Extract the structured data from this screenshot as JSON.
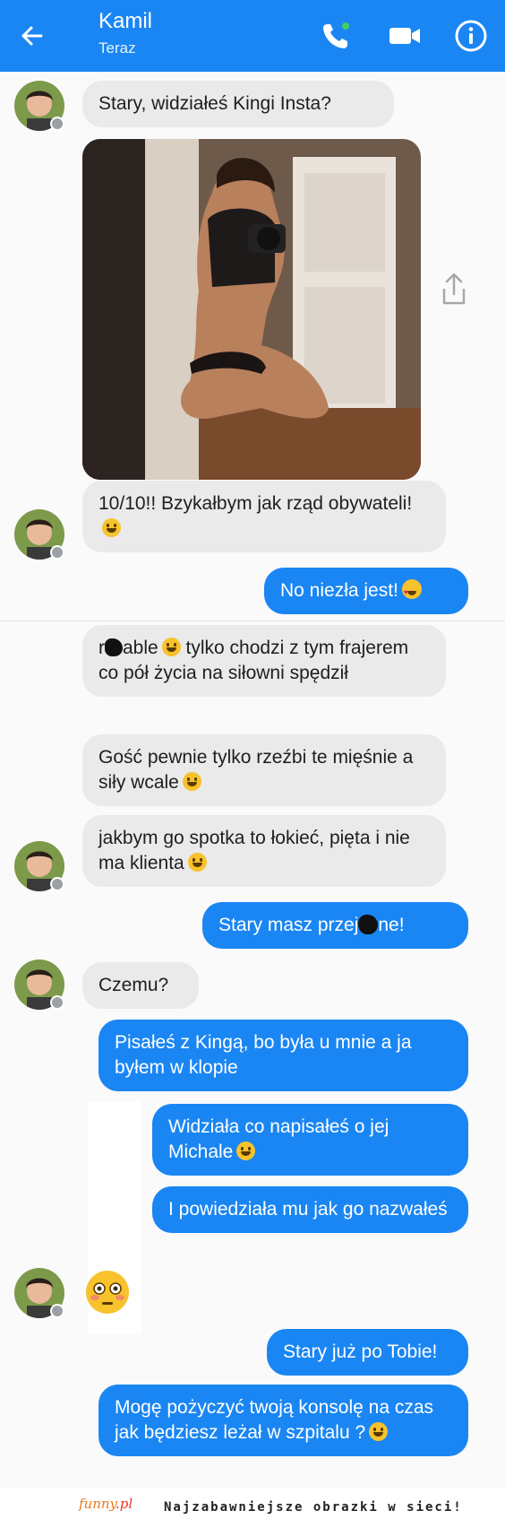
{
  "header": {
    "contact_name": "Kamil",
    "status": "Teraz",
    "back_icon": "back-arrow-icon",
    "call_icon": "phone-icon",
    "video_icon": "video-camera-icon",
    "info_icon": "info-icon",
    "color": "#1a86f3"
  },
  "messages": [
    {
      "from": "Kamil",
      "text": "Stary, widziałeś Kingi Insta?"
    },
    {
      "from": "Kamil",
      "type": "photo"
    },
    {
      "from": "Kamil",
      "text": "10/10!! Bzykałbym jak rząd obywateli!",
      "emoji": "grinning"
    },
    {
      "from": "me",
      "text": "No niezła jest!",
      "emoji": "heart-eyes"
    },
    {
      "from": "Kamil",
      "text_start": "r",
      "text_end": "able",
      "text_rest": "tylko chodzi z tym frajerem co pół życia na siłowni spędził",
      "emoji": "grinning"
    },
    {
      "from": "Kamil",
      "text": "Gość pewnie tylko rzeźbi te mięśnie a siły wcale",
      "emoji": "grinning"
    },
    {
      "from": "Kamil",
      "text": "jakbym go spotka to łokieć, pięta i nie ma klienta",
      "emoji": "grinning"
    },
    {
      "from": "me",
      "text_start": "Stary masz przej",
      "text_end": "ne!"
    },
    {
      "from": "Kamil",
      "text": "Czemu?"
    },
    {
      "from": "me",
      "text": "Pisałeś z Kingą, bo była u mnie a ja byłem w klopie"
    },
    {
      "from": "me",
      "text": "Widziała co napisałeś o jej Michale",
      "emoji": "grinning"
    },
    {
      "from": "me",
      "text": "I powiedziała mu jak go nazwałeś"
    },
    {
      "from": "Kamil",
      "type": "emoji",
      "emoji": "flushed"
    },
    {
      "from": "me",
      "text": "Stary już po Tobie!"
    },
    {
      "from": "me",
      "text": "Mogę pożyczyć twoją konsolę na czas jak będziesz leżał w szpitalu ?",
      "emoji": "grinning"
    }
  ],
  "footer": {
    "logo_text": "funny",
    "logo_suffix": ".pl",
    "tagline": "Najzabawniejsze obrazki w sieci!"
  }
}
